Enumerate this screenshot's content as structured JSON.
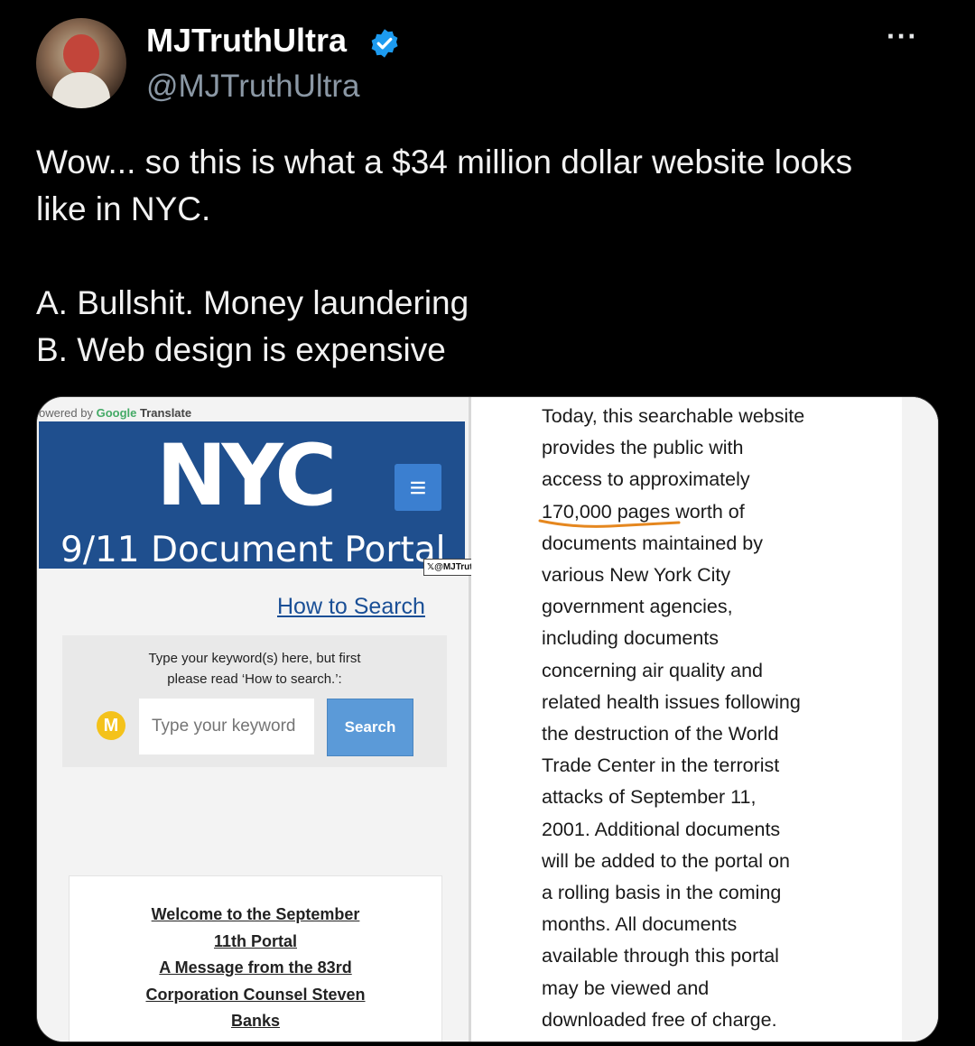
{
  "tweet": {
    "display_name": "MJTruthUltra",
    "handle": "@MJTruthUltra",
    "more_label": "···",
    "lines": [
      "Wow... so this is what a $34 million dollar website looks",
      "like in NYC.",
      "",
      "A. Bullshit. Money laundering",
      "B. Web design is expensive"
    ],
    "accent_color": "#1d9bf0"
  },
  "screenshot": {
    "powered_prefix": "owered by",
    "powered_google": "Google",
    "powered_translate": "Translate",
    "logo": "NYC",
    "menu_icon": "hamburger-icon",
    "portal_title": "9/11 Document Portal",
    "watermark": "@MJTruthUltra",
    "how_to_search": "How to Search",
    "search_hint_1": "Type your keyword(s) here, but first",
    "search_hint_2": "please read ‘How to search.’:",
    "keyword_placeholder": "Type your keyword",
    "search_button": "Search",
    "m_icon_letter": "M",
    "welcome_lines": [
      "Welcome to the September",
      "11th Portal",
      "A Message from the 83rd",
      "Corporation Counsel Steven",
      "Banks"
    ],
    "description_lines": [
      "Today, this searchable website",
      "provides the public with",
      "access to approximately",
      "170,000 pages worth of",
      "documents maintained by",
      "various New York City",
      "government agencies,",
      "including documents",
      "concerning air quality and",
      "related health issues following",
      "the destruction of the World",
      "Trade Center in the terrorist",
      "attacks of September 11,",
      "2001. Additional documents",
      "will be added to the portal on",
      "a rolling basis in the coming",
      "months. All documents",
      "available through this portal",
      "may be viewed and",
      "downloaded free of charge."
    ]
  }
}
